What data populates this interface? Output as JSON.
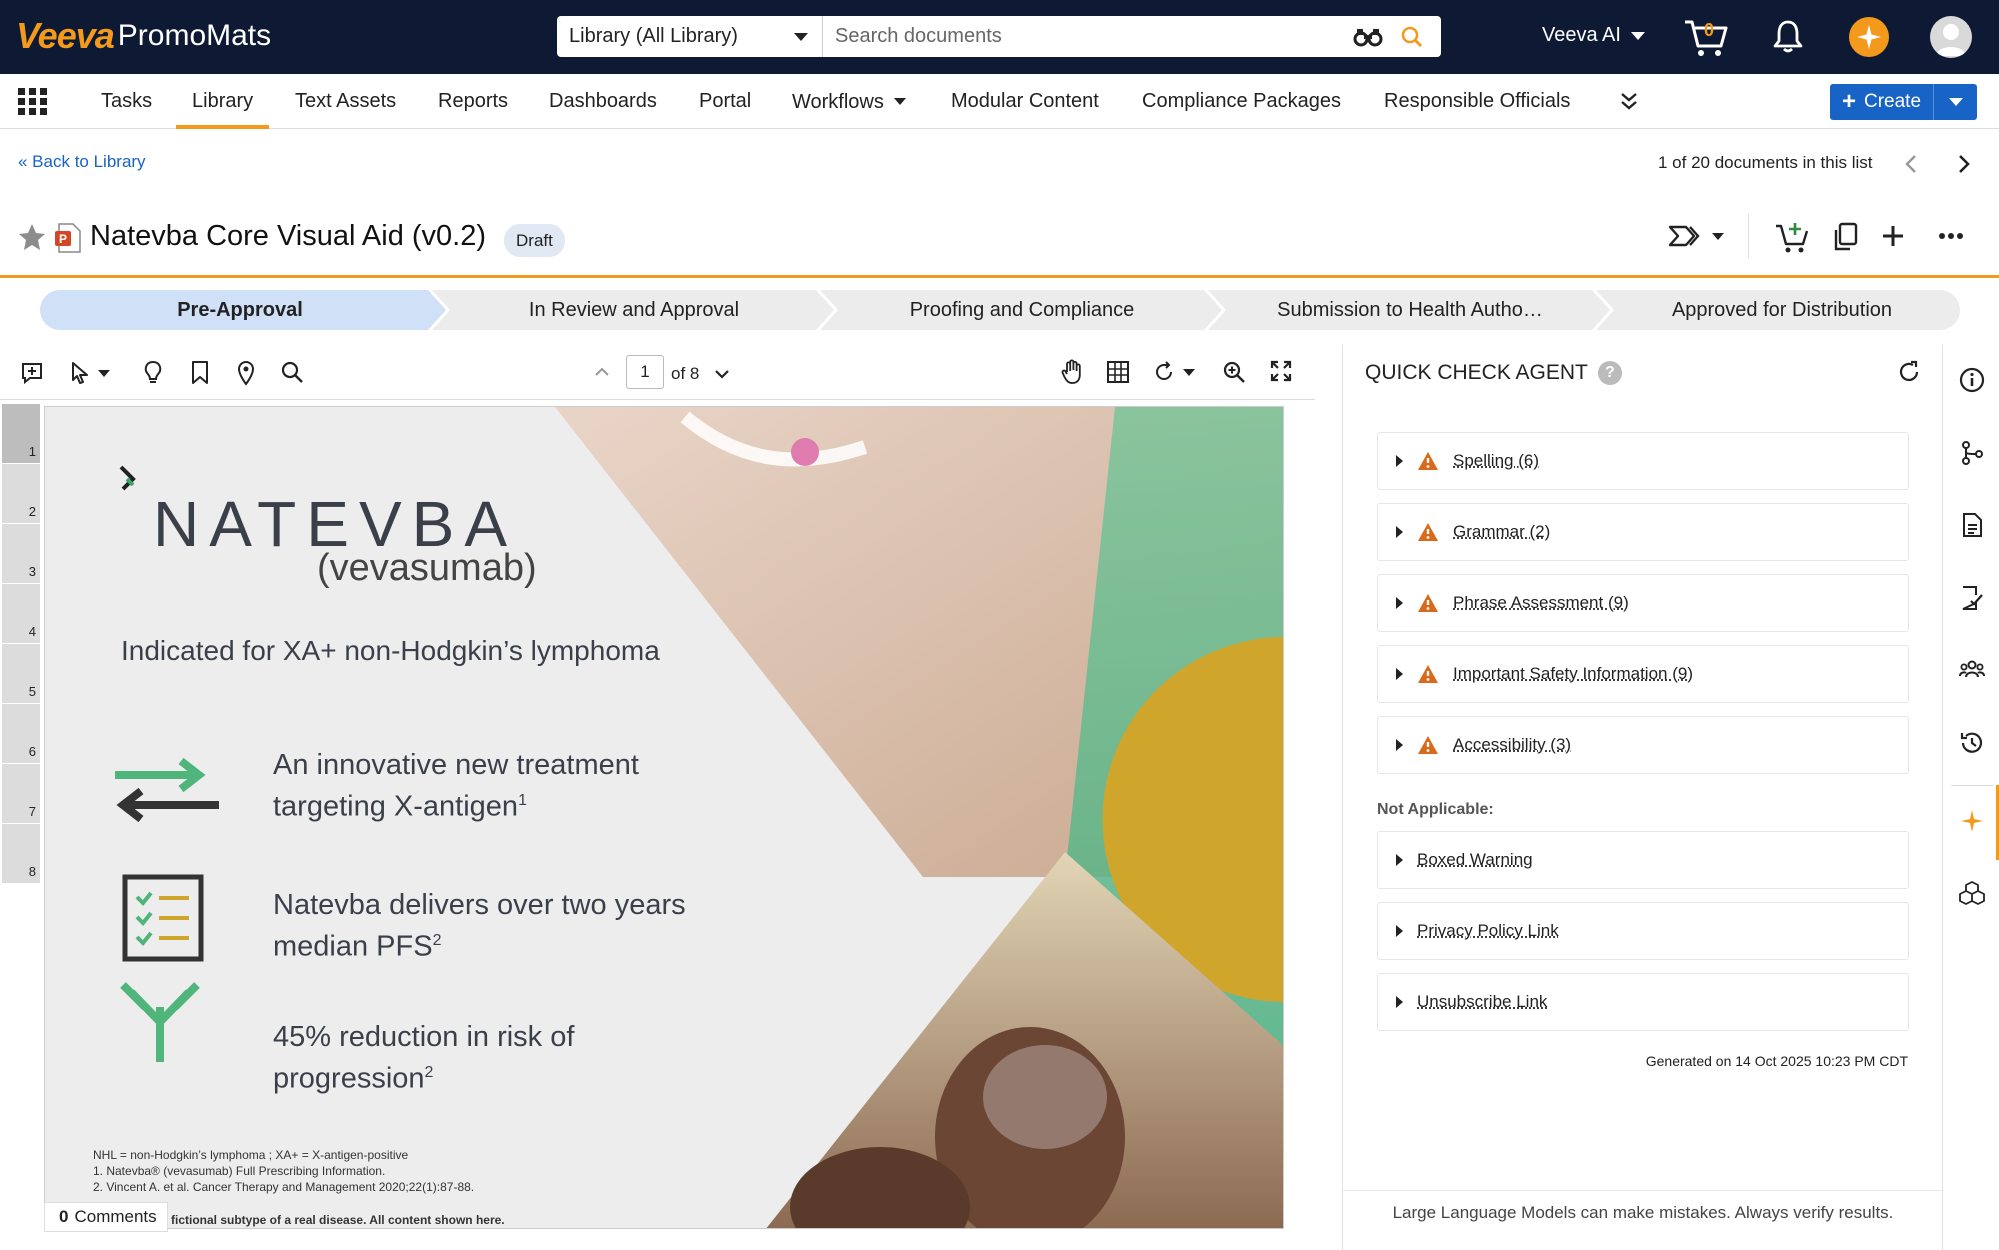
{
  "brand": {
    "logo_prefix": "Veeva",
    "logo_product": "PromoMats",
    "accent": "#f39a1c",
    "topbar_bg": "#0e1a33",
    "primary_blue": "#1863c6"
  },
  "search": {
    "scope": "Library (All Library)",
    "placeholder": "Search documents"
  },
  "header": {
    "ai_label": "Veeva AI",
    "cart_count": "0"
  },
  "nav": {
    "items": [
      "Tasks",
      "Library",
      "Text Assets",
      "Reports",
      "Dashboards",
      "Portal",
      "Workflows",
      "Modular Content",
      "Compliance Packages",
      "Responsible Officials"
    ],
    "active": "Library",
    "create_label": "Create"
  },
  "breadcrumb": {
    "back": "«  Back to Library",
    "count": "1 of 20 documents in this list"
  },
  "document": {
    "title": "Natevba Core Visual Aid (v0.2)",
    "status": "Draft"
  },
  "lifecycle": {
    "stages": [
      "Pre-Approval",
      "In Review and Approval",
      "Proofing and Compliance",
      "Submission to Health Autho…",
      "Approved for Distribution"
    ],
    "active": "Pre-Approval"
  },
  "viewer": {
    "page": "1",
    "page_total": "of 8",
    "thumbs": [
      "1",
      "2",
      "3",
      "4",
      "5",
      "6",
      "7",
      "8"
    ],
    "comments_count": "0",
    "comments_label": "Comments"
  },
  "slide": {
    "brand_name": "NATEVBA",
    "generic_name": "(vevasumab)",
    "indication": "Indicated for XA+ non-Hodgkin’s lymphoma",
    "benefits": [
      {
        "line1": "An innovative new treatment",
        "line2": "targeting X-antigen",
        "sup": "1"
      },
      {
        "line1": "Natevba delivers over two years",
        "line2": "median PFS",
        "sup": "2"
      },
      {
        "line1": "45% reduction in risk of",
        "line2": "progression",
        "sup": "2"
      }
    ],
    "footnotes": [
      "NHL = non-Hodgkin’s lymphoma ; XA+ = X-antigen-positive",
      "1. Natevba® (vevasumab) Full Prescribing Information.",
      "2. Vincent A. et al. Cancer Therapy and Management 2020;22(1):87-88."
    ],
    "disclaimer": "fictional subtype of a real disease. All content shown here."
  },
  "quick_check": {
    "title": "QUICK CHECK AGENT",
    "help": "?",
    "issues": [
      "Spelling (6)",
      "Grammar (2)",
      "Phrase Assessment (9)",
      "Important Safety Information (9)",
      "Accessibility (3)"
    ],
    "not_applicable_label": "Not Applicable:",
    "not_applicable": [
      "Boxed Warning",
      "Privacy Policy Link",
      "Unsubscribe Link"
    ],
    "generated": "Generated on 14 Oct 2025 10:23 PM CDT",
    "disclaimer": "Large Language Models can make mistakes. Always verify results."
  }
}
